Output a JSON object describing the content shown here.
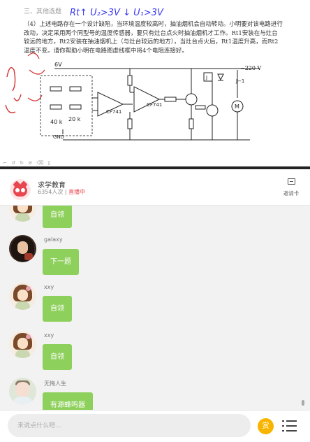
{
  "board": {
    "heading": "三、其他选题",
    "handwriting": "Rt↑ U₂>3V ↓ U₁>3V",
    "paragraph": "（4）上述电路存在一个设计缺陷，当环境温度较高时，抽油烟机会自动转动。小明要对该电路进行改动，决定采用两个同型号的温度传感器，要只有灶台点火时抽油烟机才工作。Rt1安装在与灶台较远的地方，Rt2安装在抽油烟机上（与灶台较远的地方），当灶台点火后，Rt1温度升高，而Rt2温度不变。请你帮助小明在电路图虚线框中将4个电阻连接好。",
    "circuit": {
      "v6": "6V",
      "supply": "−220 V",
      "relay": "J−1",
      "gnd": "GND",
      "ic1": "CF741",
      "ic2": "CF741",
      "r_a": "40 k",
      "r_b": "20 k",
      "motor": "M"
    },
    "tools": "⌐ ↺ ↻ ⊘ ⌫ ▯"
  },
  "header": {
    "channel_name": "求学教育",
    "viewers": "6354人次",
    "separator": "|",
    "live_status": "直播中",
    "invite_label": "邀请卡"
  },
  "chat": {
    "messages": [
      {
        "nick": "",
        "text": "自领",
        "avatar": "girl-sketch-avatar"
      },
      {
        "nick": "galaxy",
        "text": "下一题",
        "avatar": "dark-hair-avatar"
      },
      {
        "nick": "xxy",
        "text": "自领",
        "avatar": "girl-sketch-avatar"
      },
      {
        "nick": "xxy",
        "text": "自领",
        "avatar": "girl-sketch-avatar"
      },
      {
        "nick": "无悔人生",
        "text": "有源蜂鸣器",
        "avatar": "baby-avatar"
      }
    ]
  },
  "footer": {
    "input_placeholder": "来说点什么吧...",
    "reward_label": "赏",
    "menu_icon": "list-menu-icon"
  },
  "colors": {
    "bubble": "#8ed05c",
    "live": "#e8474f",
    "reward": "#f7b500"
  }
}
